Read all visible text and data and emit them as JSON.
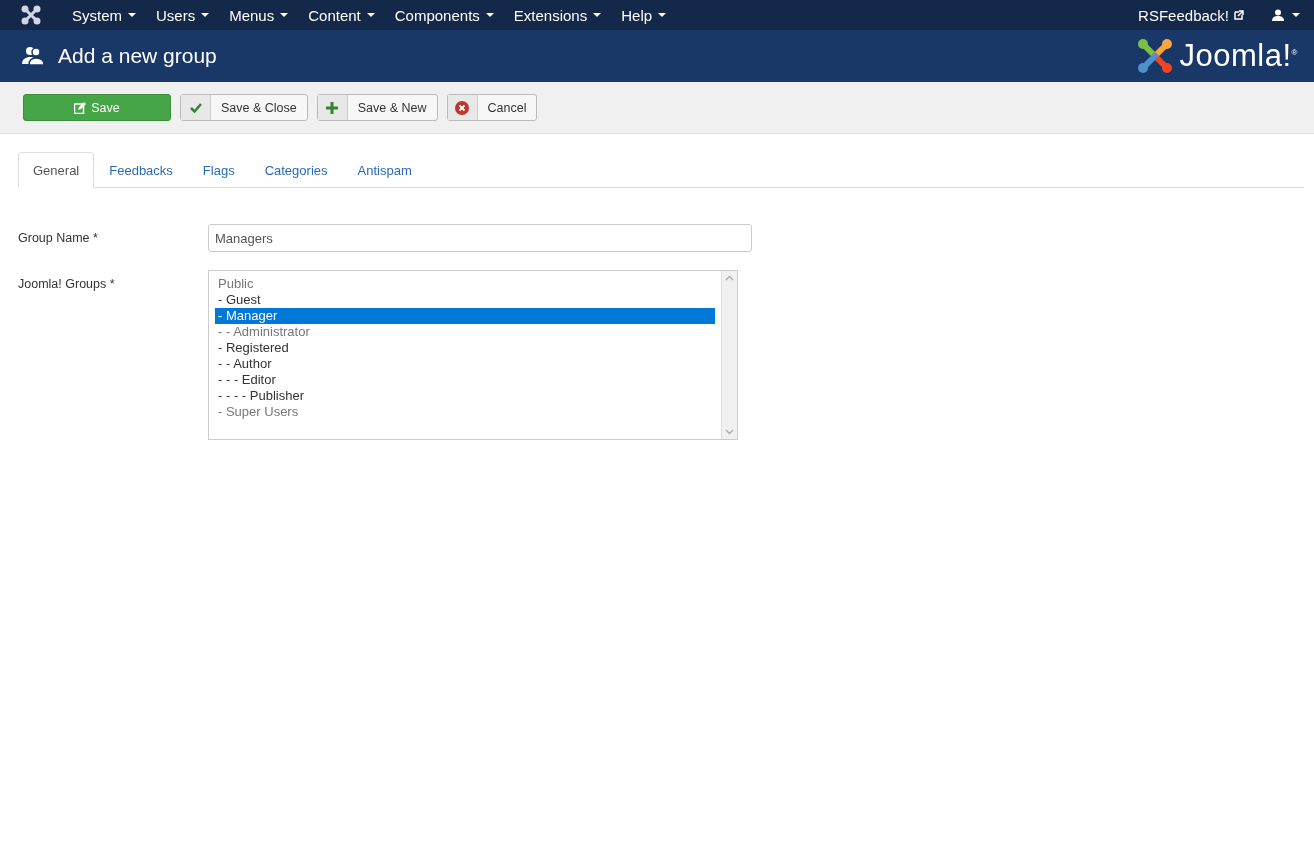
{
  "menu": [
    {
      "label": "System"
    },
    {
      "label": "Users"
    },
    {
      "label": "Menus"
    },
    {
      "label": "Content"
    },
    {
      "label": "Components"
    },
    {
      "label": "Extensions"
    },
    {
      "label": "Help"
    }
  ],
  "site_link": "RSFeedback!",
  "header": {
    "title": "Add a new group",
    "logo": "Joomla!$^{®}$"
  },
  "toolbar": [
    {
      "label": "Save",
      "kind": "primary"
    },
    {
      "label": "Save & Close",
      "kind": "check"
    },
    {
      "label": "Save & New",
      "kind": "plus"
    },
    {
      "label": "Cancel",
      "kind": "cancel"
    }
  ],
  "tabs": [
    {
      "label": "General",
      "selected": true
    },
    {
      "label": "Feedbacks",
      "selected": false
    },
    {
      "label": "Flags",
      "selected": false
    },
    {
      "label": "Categories",
      "selected": false
    },
    {
      "label": "Antispam",
      "selected": false
    }
  ],
  "form": {
    "group_name": {
      "label": "Group Name *",
      "value": "Managers"
    },
    "joomla_groups": {
      "label": "Joomla! Groups *",
      "options": [
        {
          "label": "Public",
          "selected": false,
          "disabled": true
        },
        {
          "label": "- Guest",
          "selected": false,
          "disabled": false
        },
        {
          "label": "- Manager",
          "selected": true,
          "disabled": false
        },
        {
          "label": "- - Administrator",
          "selected": false,
          "disabled": true
        },
        {
          "label": "- Registered",
          "selected": false,
          "disabled": false
        },
        {
          "label": "- - Author",
          "selected": false,
          "disabled": false
        },
        {
          "label": "- - - Editor",
          "selected": false,
          "disabled": false
        },
        {
          "label": "- - - - Publisher",
          "selected": false,
          "disabled": false
        },
        {
          "label": "- Super Users",
          "selected": false,
          "disabled": true
        }
      ]
    }
  }
}
